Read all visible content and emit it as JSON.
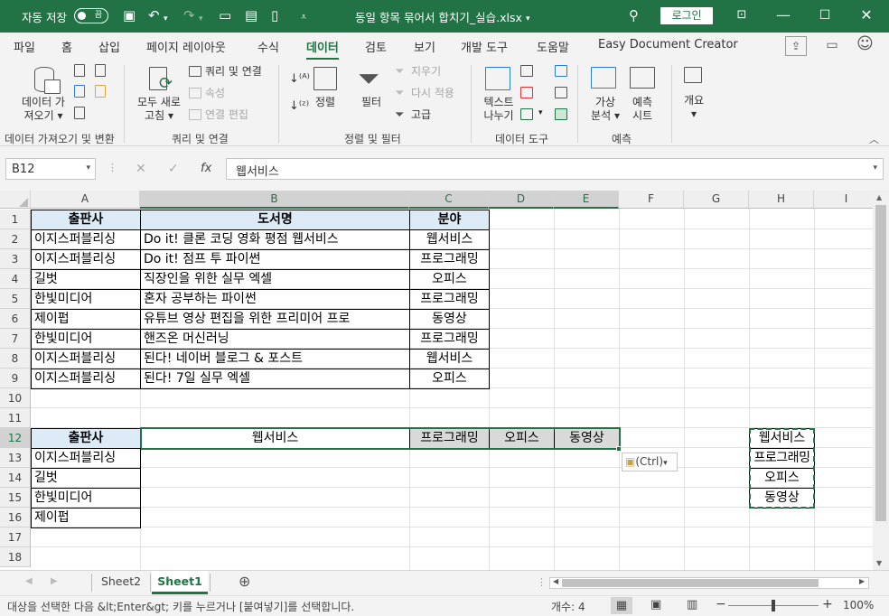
{
  "titlebar": {
    "autosave": "자동 저장",
    "toggle": "끔",
    "filename": "동일 항목 묶어서 합치기_실습.xlsx",
    "login": "로그인"
  },
  "menu": [
    "파일",
    "홈",
    "삽입",
    "페이지 레이아웃",
    "수식",
    "데이터",
    "검토",
    "보기",
    "개발 도구",
    "도움말",
    "Easy Document Creator"
  ],
  "ribbon": {
    "get_data": [
      "데이터 가",
      "져오기"
    ],
    "refresh_all": [
      "모두 새로",
      "고침"
    ],
    "queries_conn": "쿼리 및 연결",
    "properties": "속성",
    "edit_links": "연결 편집",
    "sort": "정렬",
    "filter": "필터",
    "clear": "지우기",
    "reapply": "다시 적용",
    "advanced": "고급",
    "text_to_cols": [
      "텍스트",
      "나누기"
    ],
    "whatif": [
      "가상",
      "분석"
    ],
    "forecast": [
      "예측",
      "시트"
    ],
    "outline": "개요",
    "groups": [
      "데이터 가져오기 및 변환",
      "쿼리 및 연결",
      "정렬 및 필터",
      "데이터 도구",
      "예측"
    ]
  },
  "formula": {
    "namebox": "B12",
    "fx": "fx",
    "value": "웹서비스"
  },
  "columns": [
    "A",
    "B",
    "C",
    "D",
    "E",
    "F",
    "G",
    "H",
    "I"
  ],
  "rows": [
    "1",
    "2",
    "3",
    "4",
    "5",
    "6",
    "7",
    "8",
    "9",
    "10",
    "11",
    "12",
    "13",
    "14",
    "15",
    "16",
    "17",
    "18"
  ],
  "table1": {
    "headers": [
      "출판사",
      "도서명",
      "분야"
    ],
    "rows": [
      [
        "이지스퍼블리싱",
        "Do it! 클론 코딩 영화 평점 웹서비스",
        "웹서비스"
      ],
      [
        "이지스퍼블리싱",
        "Do it! 점프 투 파이썬",
        "프로그래밍"
      ],
      [
        "길벗",
        "직장인을 위한 실무 엑셀",
        "오피스"
      ],
      [
        "한빛미디어",
        "혼자 공부하는 파이썬",
        "프로그래밍"
      ],
      [
        "제이펍",
        "유튜브 영상 편집을 위한 프리미어 프로",
        "동영상"
      ],
      [
        "한빛미디어",
        "핸즈온 머신러닝",
        "프로그래밍"
      ],
      [
        "이지스퍼블리싱",
        "된다! 네이버 블로그 & 포스트",
        "웹서비스"
      ],
      [
        "이지스퍼블리싱",
        "된다! 7일 실무 엑셀",
        "오피스"
      ]
    ]
  },
  "table2": {
    "header": "출판사",
    "pasted": [
      "웹서비스",
      "프로그래밍",
      "오피스",
      "동영상"
    ],
    "publishers": [
      "이지스퍼블리싱",
      "길벗",
      "한빛미디어",
      "제이펍"
    ]
  },
  "copy_source": [
    "웹서비스",
    "프로그래밍",
    "오피스",
    "동영상"
  ],
  "paste_tag": "(Ctrl)",
  "sheets": [
    "Sheet2",
    "Sheet1"
  ],
  "status": {
    "message": "대상을 선택한 다음 &lt;Enter&gt; 키를 누르거나 [붙여넣기]를 선택합니다.",
    "count": "개수: 4",
    "zoom": "100%"
  }
}
